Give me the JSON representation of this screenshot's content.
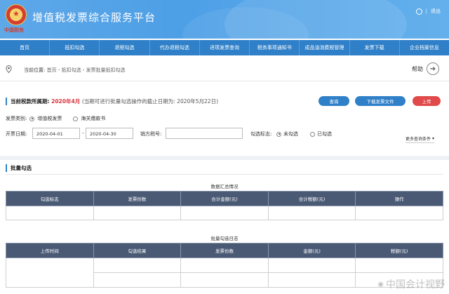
{
  "header": {
    "emblem_text": "中国税务",
    "title": "增值税发票综合服务平台",
    "separator": "|",
    "logout": "退出",
    "bg_color": "#4d9fe6"
  },
  "nav": {
    "items": [
      "首页",
      "抵扣勾选",
      "退税勾选",
      "代办退税勾选",
      "进项发票查询",
      "税务事项通知书",
      "成品油消费税管理",
      "发票下载",
      "企业档案信息"
    ],
    "bg_color": "#2f80c8"
  },
  "breadcrumb": {
    "label": "当前位置:",
    "home": "首页",
    "sep1": " - ",
    "level2": "抵扣勾选",
    "sep2": " - ",
    "level3": "发票批量抵扣勾选",
    "help": "帮助",
    "help_icon": "arrow-right-circle-icon"
  },
  "period": {
    "label": "当前税款所属期:",
    "value": "2020年4月",
    "note": "(当期可进行批量勾选操作的截止日期为: 2020年5月22日)"
  },
  "buttons": {
    "query": "查询",
    "download": "下载发票文件",
    "upload": "上传"
  },
  "filters": {
    "invoice_type_label": "发票类别:",
    "type_vat": "增值税发票",
    "type_customs": "海关缴款书",
    "date_label": "开票日期:",
    "date_from": "2020-04-01",
    "date_sep": "-",
    "date_to": "2020-04-30",
    "seller_tax_label": "销方税号:",
    "seller_tax_value": "",
    "check_flag_label": "勾选标志:",
    "unchecked": "未勾选",
    "checked": "已勾选",
    "more": "更多查询条件"
  },
  "batch": {
    "title": "批量勾选",
    "summary_caption": "数据汇总情况",
    "summary_columns": [
      "勾选标志",
      "发票份数",
      "合计金额(元)",
      "合计税额(元)",
      "操作"
    ],
    "log_caption": "批量勾选日志",
    "log_columns": [
      "上传时间",
      "勾选结果",
      "发票份数",
      "金额(元)",
      "税额(元)"
    ]
  },
  "watermark": {
    "icon": "weibo-icon",
    "text": "中国会计视野"
  }
}
